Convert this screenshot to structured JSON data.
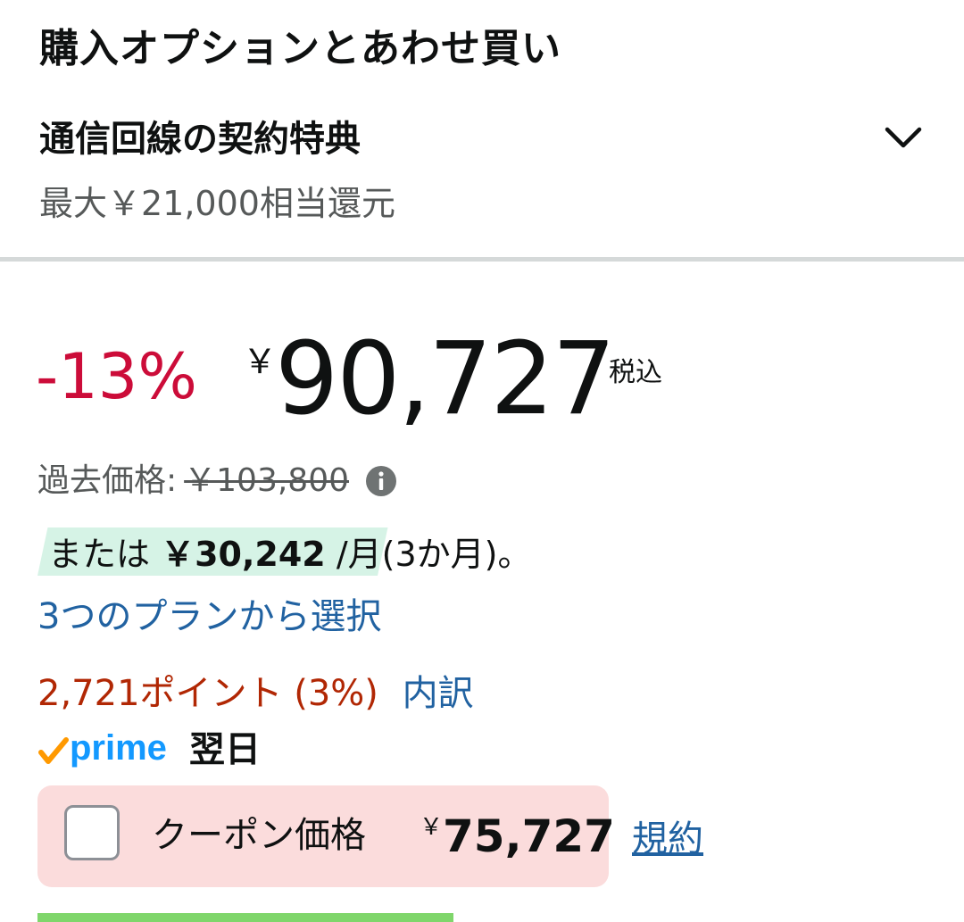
{
  "header": {
    "title": "購入オプションとあわせ買い"
  },
  "offer": {
    "title": "通信回線の契約特典",
    "subtitle": "最大￥21,000相当還元",
    "icon": "chevron-down-icon"
  },
  "price": {
    "discount": "-13%",
    "currency": "￥",
    "amount": "90,727",
    "tax_label": "税込"
  },
  "past_price": {
    "label": "過去価格:",
    "value": "￥103,800",
    "icon": "info-icon"
  },
  "installment": {
    "prefix": "または",
    "amount": "￥30,242",
    "suffix": "/月(3か月)。",
    "highlight_color": "#d6f3e6"
  },
  "plan_link": {
    "label": "3つのプランから選択"
  },
  "points": {
    "label": "2,721ポイント (3%)",
    "breakdown_label": "内訳"
  },
  "prime": {
    "logo_text": "prime",
    "delivery": "翌日"
  },
  "coupon": {
    "label": "クーポン価格",
    "currency": "￥",
    "price": "75,727",
    "checked": false,
    "terms_label": "規約"
  },
  "colors": {
    "discount": "#cc0c39",
    "link": "#2162a1",
    "points": "#b12704",
    "coupon_bg": "#fbdcdc",
    "prime_blue": "#1399ff",
    "prime_check": "#ff9900"
  }
}
